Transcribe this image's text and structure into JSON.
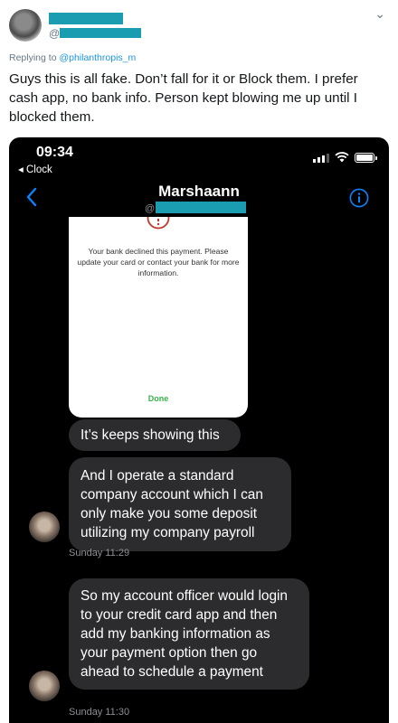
{
  "tweet": {
    "handle_prefix": "@",
    "more_glyph": "⌄",
    "replying_prefix": "Replying to",
    "replying_mention": "@philanthropis_m",
    "text": "Guys this is all fake. Don’t fall for it or Block them. I prefer cash app, no bank info. Person kept blowing me up until I blocked them."
  },
  "phone": {
    "status": {
      "time": "09:34",
      "back_app": "◂ Clock"
    },
    "nav": {
      "contact_name": "Marshaann",
      "contact_at": "@"
    },
    "payment_screenshot": {
      "message": "Your bank declined this payment. Please update your card or contact your bank for more information.",
      "done_label": "Done"
    },
    "messages": [
      {
        "text": "It’s keeps showing this"
      },
      {
        "text": "And I operate a standard company account which I can only make you some deposit utilizing my company payroll"
      },
      {
        "text": "So my account officer would login to your credit card app and then add my banking information as your payment option then go ahead to schedule a payment"
      }
    ],
    "timestamps": [
      "Sunday 11:29",
      "Sunday 11:30"
    ]
  },
  "colors": {
    "redaction": "#1a9db0",
    "mention": "#1b95e0",
    "ios_blue": "#0a84ff",
    "bubble": "#2c2c2e",
    "done_green": "#37b34a",
    "alert_red": "#c0392b"
  }
}
